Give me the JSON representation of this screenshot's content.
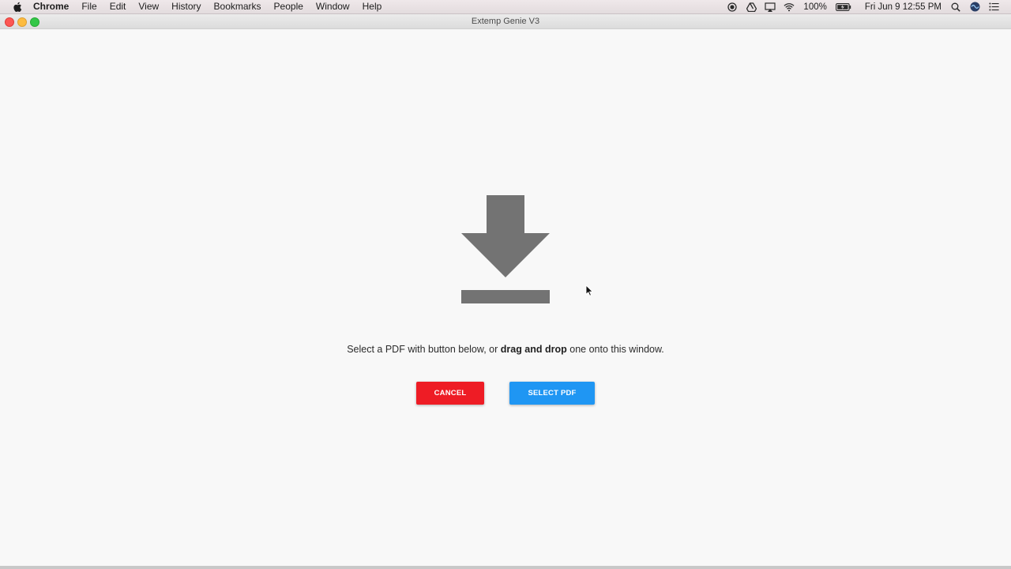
{
  "menubar": {
    "apple_icon": "apple-icon",
    "app_name": "Chrome",
    "items": [
      "File",
      "Edit",
      "View",
      "History",
      "Bookmarks",
      "People",
      "Window",
      "Help"
    ],
    "battery": "100%",
    "datetime": "Fri Jun 9  12:55 PM"
  },
  "window": {
    "title": "Extemp Genie V3"
  },
  "main": {
    "icon": "download-icon",
    "instruction_prefix": "Select a PDF with button below, or ",
    "instruction_bold": "drag and drop",
    "instruction_suffix": " one onto this window.",
    "cancel_label": "CANCEL",
    "select_label": "SELECT PDF"
  },
  "colors": {
    "cancel": "#ee1c25",
    "select": "#1f96f3",
    "icon": "#737373"
  }
}
